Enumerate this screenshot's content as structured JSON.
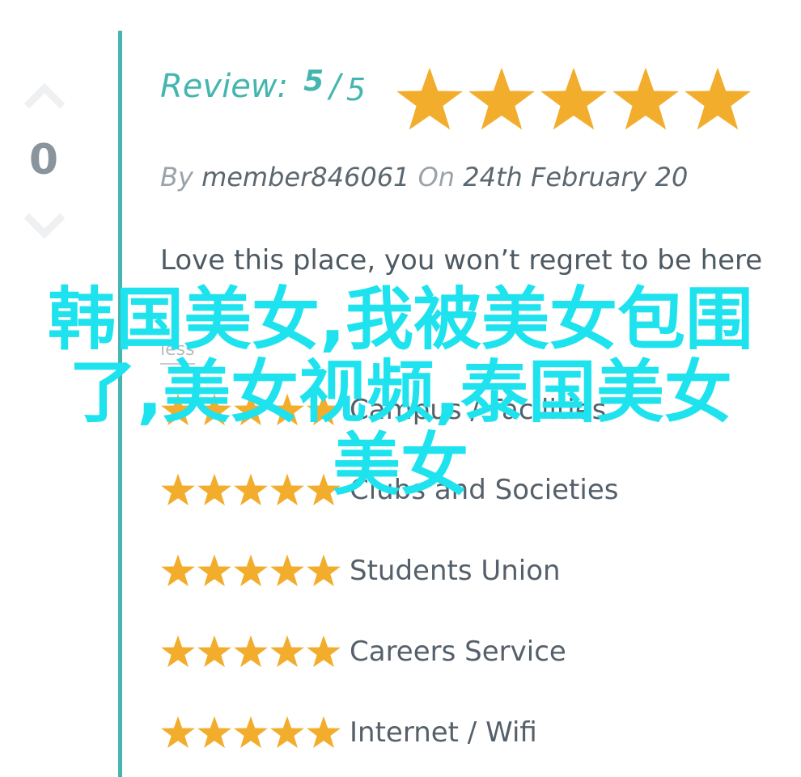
{
  "votes": {
    "count": "0"
  },
  "review": {
    "label": "Review:",
    "score": "5",
    "slash": "/",
    "max": "5",
    "rating": 5,
    "star_color": "#f3ad2d",
    "accent_color": "#45b5b0"
  },
  "byline": {
    "by": "By",
    "author": "member846061",
    "on": "On",
    "date": "24th February 20"
  },
  "text": "Love this place, you won’t regret to be here",
  "less_link": "less",
  "categories": [
    {
      "label": "Campus / Facilities",
      "rating": 5
    },
    {
      "label": "Clubs and Societies",
      "rating": 5
    },
    {
      "label": "Students Union",
      "rating": 5
    },
    {
      "label": "Careers Service",
      "rating": 5
    },
    {
      "label": "Internet / Wifi",
      "rating": 5
    }
  ],
  "overlay": {
    "line1": "韩国美女,我被美女包围",
    "line2": "了,美女视频,泰国美女",
    "line3": "美女",
    "color": "#1ee3ee"
  }
}
